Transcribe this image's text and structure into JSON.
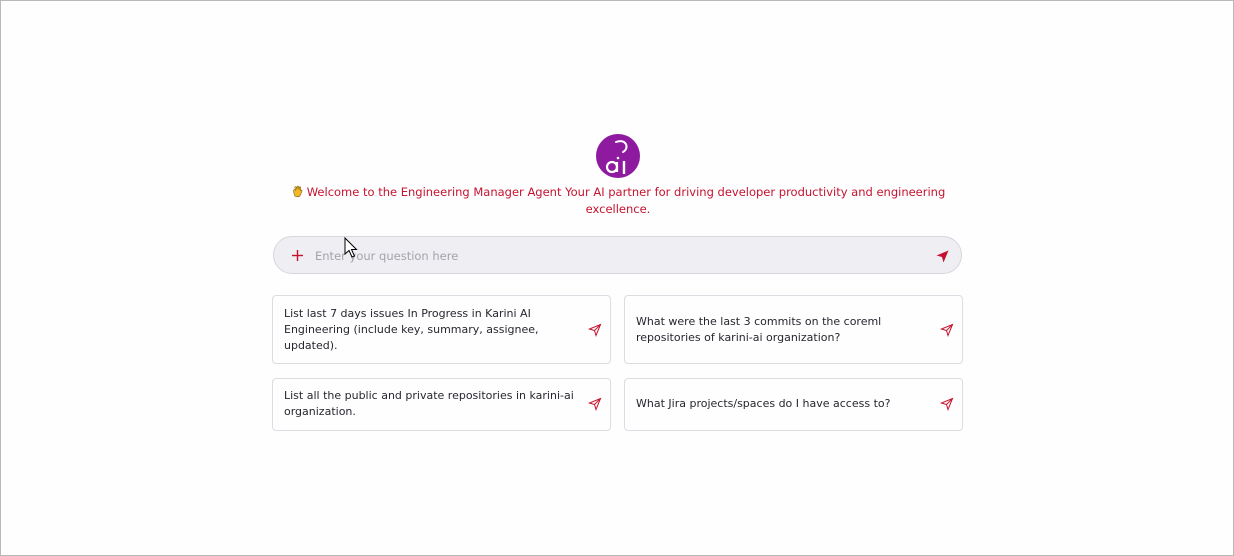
{
  "logo": {
    "icon": "brand-logo-icon",
    "color": "#8d1a9f"
  },
  "welcome": {
    "icon": "waving-hand-icon",
    "text": "Welcome to the Engineering Manager Agent Your AI partner for driving developer productivity and engineering excellence.",
    "color": "#c5132f"
  },
  "search": {
    "placeholder": "Enter your question here",
    "value": "",
    "add_icon": "plus-icon",
    "send_icon": "send-icon"
  },
  "suggestions": [
    {
      "text": "List last 7 days issues In Progress in Karini AI Engineering (include key, summary, assignee, updated).",
      "icon": "send-icon"
    },
    {
      "text": "What were the last 3 commits on the coreml repositories of karini-ai organization?",
      "icon": "send-icon"
    },
    {
      "text": "List all the public and private repositories in karini-ai organization.",
      "icon": "send-icon"
    },
    {
      "text": "What Jira projects/spaces do I have access to?",
      "icon": "send-icon"
    }
  ],
  "cursor": {
    "icon": "mouse-pointer-icon"
  }
}
